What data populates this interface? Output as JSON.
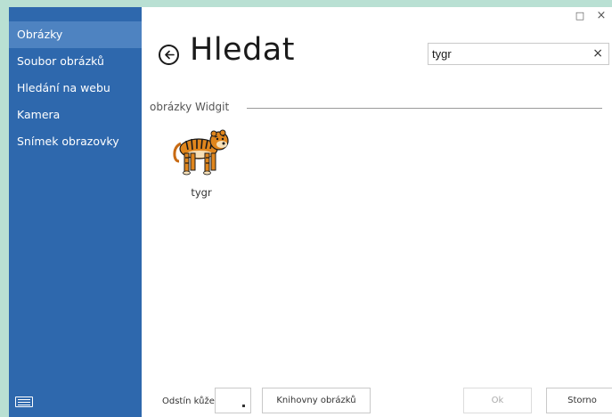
{
  "sidebar": {
    "items": [
      {
        "label": "Obrázky",
        "active": true
      },
      {
        "label": "Soubor obrázků",
        "active": false
      },
      {
        "label": "Hledání na webu",
        "active": false
      },
      {
        "label": "Kamera",
        "active": false
      },
      {
        "label": "Snímek obrazovky",
        "active": false
      }
    ],
    "keyboard_icon": "keyboard-icon"
  },
  "window_controls": {
    "maximize": "□",
    "close": "×"
  },
  "header": {
    "title": "Hledat",
    "back_icon": "back-arrow-circle-icon"
  },
  "search": {
    "value": "tygr",
    "clear_icon": "×"
  },
  "section": {
    "label": "obrázky Widgit"
  },
  "results": [
    {
      "caption": "tygr",
      "icon": "tiger-icon"
    }
  ],
  "footer": {
    "skin_tone_label": "Odstín kůže",
    "library_button": "Knihovny obrázků",
    "ok_button": "Ok",
    "cancel_button": "Storno"
  },
  "colors": {
    "sidebar": "#2e68ad",
    "sidebar_active": "#4e83c1",
    "background": "#b9e0d3"
  }
}
